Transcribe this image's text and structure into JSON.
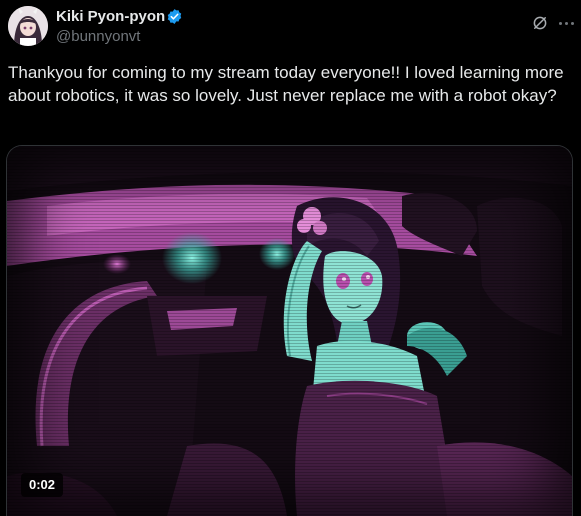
{
  "author": {
    "display_name": "Kiki Pyon-pyon",
    "handle": "@bunnyonvt",
    "verified_color": "#1d9bf0"
  },
  "actions": {
    "grok_icon": "grok-icon",
    "more_icon": "more-icon"
  },
  "tweet": {
    "text": "Thankyou for coming to my stream today everyone!! I loved learning more about robotics, it was so lovely. Just never replace me with a robot okay?"
  },
  "media": {
    "type": "video",
    "duration": "0:02",
    "palette": {
      "pink": "#c05ab8",
      "teal": "#5fd8c8",
      "dark": "#120a12"
    }
  }
}
